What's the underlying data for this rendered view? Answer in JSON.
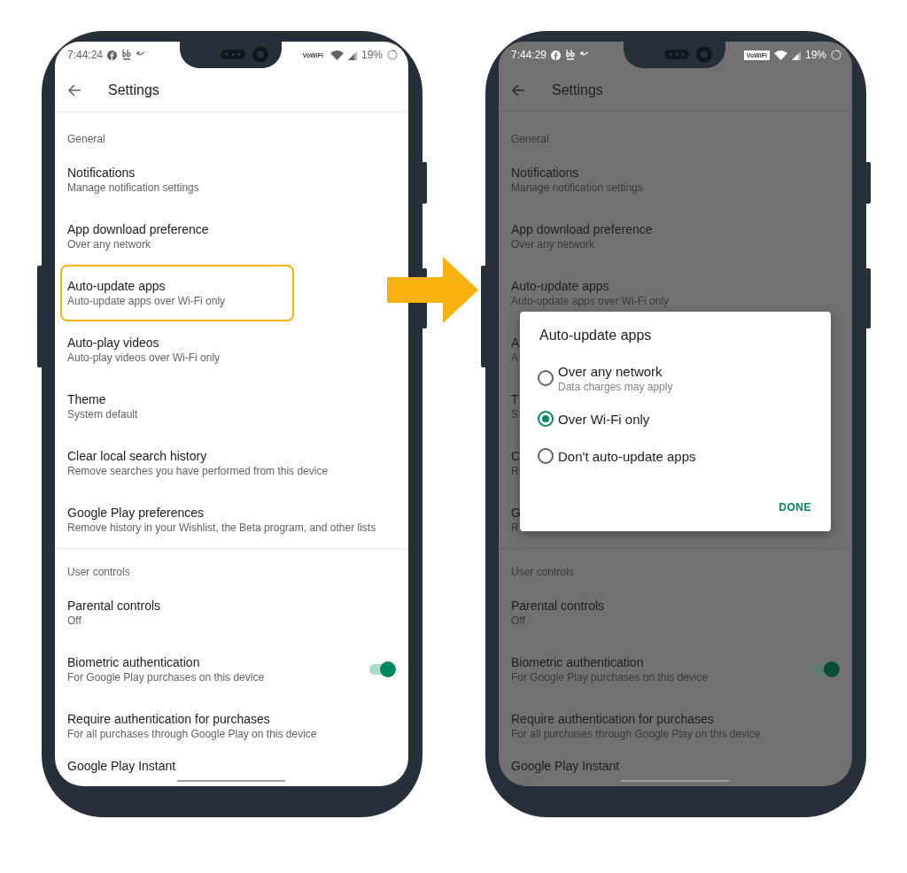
{
  "phones": [
    {
      "dimmed": false,
      "status_bar": {
        "time": "7:44:24",
        "badge": "VoWiFi",
        "battery": "19%"
      },
      "app_bar": {
        "title": "Settings"
      },
      "sections": [
        {
          "header": "General",
          "items": [
            {
              "kind": "text",
              "title": "Notifications",
              "subtitle": "Manage notification settings",
              "highlighted": false
            },
            {
              "kind": "text",
              "title": "App download preference",
              "subtitle": "Over any network",
              "highlighted": false
            },
            {
              "kind": "text",
              "title": "Auto-update apps",
              "subtitle": "Auto-update apps over Wi-Fi only",
              "highlighted": true
            },
            {
              "kind": "text",
              "title": "Auto-play videos",
              "subtitle": "Auto-play videos over Wi-Fi only",
              "highlighted": false
            },
            {
              "kind": "text",
              "title": "Theme",
              "subtitle": "System default",
              "highlighted": false
            },
            {
              "kind": "text",
              "title": "Clear local search history",
              "subtitle": "Remove searches you have performed from this device",
              "highlighted": false
            },
            {
              "kind": "text",
              "title": "Google Play preferences",
              "subtitle": "Remove history in your Wishlist, the Beta program, and other lists",
              "highlighted": false
            }
          ]
        },
        {
          "header": "User controls",
          "items": [
            {
              "kind": "text",
              "title": "Parental controls",
              "subtitle": "Off",
              "highlighted": false
            },
            {
              "kind": "toggle",
              "title": "Biometric authentication",
              "subtitle": "For Google Play purchases on this device",
              "on": true,
              "highlighted": false
            },
            {
              "kind": "text",
              "title": "Require authentication for purchases",
              "subtitle": "For all purchases through Google Play on this device",
              "highlighted": false
            },
            {
              "kind": "text",
              "title": "Google Play Instant",
              "highlighted": false
            }
          ]
        }
      ]
    },
    {
      "dimmed": true,
      "status_bar": {
        "time": "7:44:29",
        "badge": "VoWiFi",
        "battery": "19%"
      },
      "app_bar": {
        "title": "Settings"
      },
      "sections": [
        {
          "header": "General",
          "items": [
            {
              "kind": "text",
              "title": "Notifications",
              "subtitle": "Manage notification settings",
              "highlighted": false
            },
            {
              "kind": "text",
              "title": "App download preference",
              "subtitle": "Over any network",
              "highlighted": false
            },
            {
              "kind": "text",
              "title": "Auto-update apps",
              "subtitle": "Auto-update apps over Wi-Fi only",
              "highlighted": false
            },
            {
              "kind": "text",
              "title": "A",
              "subtitle": "A",
              "highlighted": false
            },
            {
              "kind": "text",
              "title": "T",
              "subtitle": "S",
              "highlighted": false
            },
            {
              "kind": "text",
              "title": "C",
              "subtitle": "R",
              "highlighted": false
            },
            {
              "kind": "text",
              "title": "G",
              "subtitle": "R",
              "highlighted": false
            }
          ]
        },
        {
          "header": "User controls",
          "items": [
            {
              "kind": "text",
              "title": "Parental controls",
              "subtitle": "Off",
              "highlighted": false
            },
            {
              "kind": "toggle",
              "title": "Biometric authentication",
              "subtitle": "For Google Play purchases on this device",
              "on": true,
              "highlighted": false
            },
            {
              "kind": "text",
              "title": "Require authentication for purchases",
              "subtitle": "For all purchases through Google Play on this device",
              "highlighted": false
            },
            {
              "kind": "text",
              "title": "Google Play Instant",
              "highlighted": false
            }
          ]
        }
      ],
      "dialog": {
        "title": "Auto-update apps",
        "options": [
          {
            "label": "Over any network",
            "hint": "Data charges may apply",
            "selected": false
          },
          {
            "label": "Over Wi-Fi only",
            "selected": true
          },
          {
            "label": "Don't auto-update apps",
            "selected": false
          }
        ],
        "button": "DONE"
      }
    }
  ]
}
